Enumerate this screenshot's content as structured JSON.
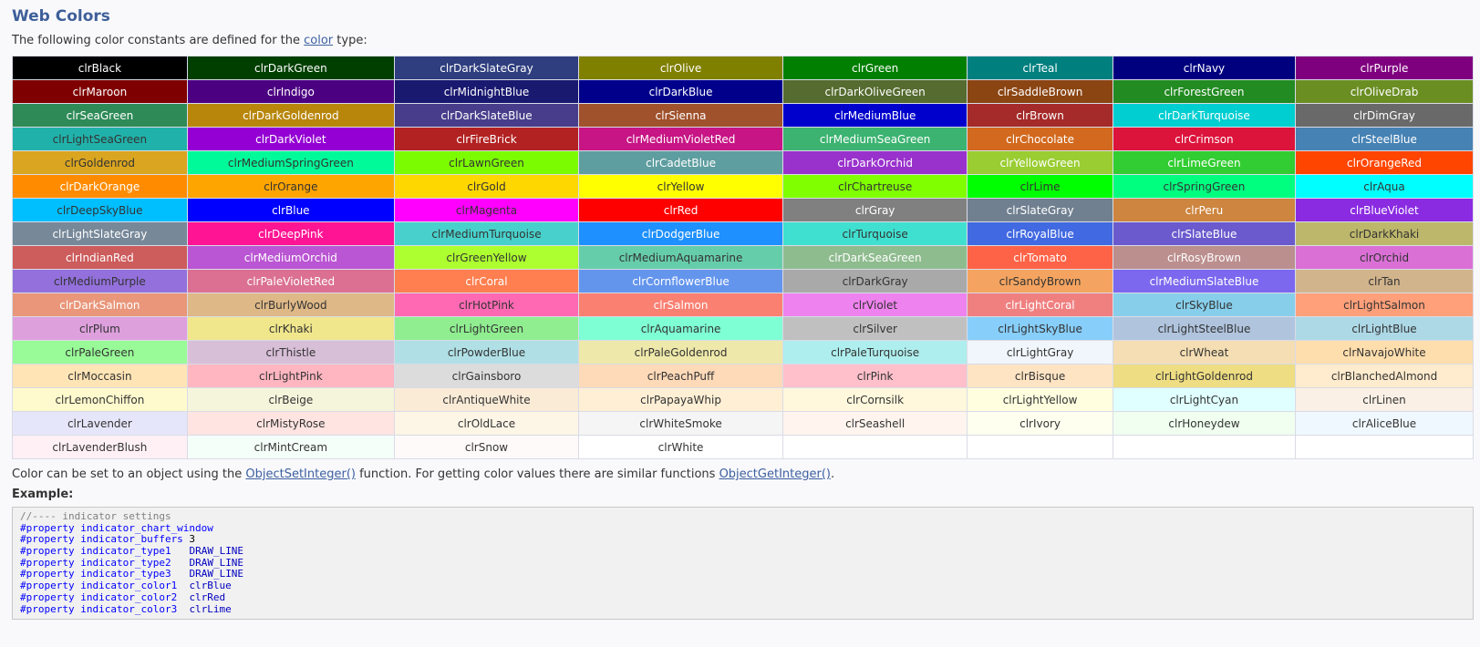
{
  "title": "Web Colors",
  "intro": {
    "before": "The following color constants are defined for the ",
    "link": "color",
    "after": " type:"
  },
  "columns": [
    185,
    219,
    195,
    216,
    195,
    154,
    193,
    188
  ],
  "colors": [
    [
      [
        "clrBlack",
        "#000000",
        "#ffffff"
      ],
      [
        "clrDarkGreen",
        "#003f00",
        "#ffffff"
      ],
      [
        "clrDarkSlateGray",
        "#2f3e7e",
        "#ffffff"
      ],
      [
        "clrOlive",
        "#7f7f00",
        "#ffffff"
      ],
      [
        "clrGreen",
        "#007f00",
        "#ffffff"
      ],
      [
        "clrTeal",
        "#007f7f",
        "#ffffff"
      ],
      [
        "clrNavy",
        "#00007f",
        "#ffffff"
      ],
      [
        "clrPurple",
        "#7f007f",
        "#ffffff"
      ]
    ],
    [
      [
        "clrMaroon",
        "#7f0000",
        "#ffffff"
      ],
      [
        "clrIndigo",
        "#4b0082",
        "#ffffff"
      ],
      [
        "clrMidnightBlue",
        "#191970",
        "#ffffff"
      ],
      [
        "clrDarkBlue",
        "#00008b",
        "#ffffff"
      ],
      [
        "clrDarkOliveGreen",
        "#556b2f",
        "#ffffff"
      ],
      [
        "clrSaddleBrown",
        "#8b4513",
        "#ffffff"
      ],
      [
        "clrForestGreen",
        "#228b22",
        "#ffffff"
      ],
      [
        "clrOliveDrab",
        "#6b8e23",
        "#ffffff"
      ]
    ],
    [
      [
        "clrSeaGreen",
        "#2e8b57",
        "#ffffff"
      ],
      [
        "clrDarkGoldenrod",
        "#b8860b",
        "#ffffff"
      ],
      [
        "clrDarkSlateBlue",
        "#483d8b",
        "#ffffff"
      ],
      [
        "clrSienna",
        "#a0522d",
        "#ffffff"
      ],
      [
        "clrMediumBlue",
        "#0000cd",
        "#ffffff"
      ],
      [
        "clrBrown",
        "#a52a2a",
        "#ffffff"
      ],
      [
        "clrDarkTurquoise",
        "#00ced1",
        "#ffffff"
      ],
      [
        "clrDimGray",
        "#696969",
        "#ffffff"
      ]
    ],
    [
      [
        "clrLightSeaGreen",
        "#20b2aa",
        "#333333"
      ],
      [
        "clrDarkViolet",
        "#9400d3",
        "#ffffff"
      ],
      [
        "clrFireBrick",
        "#b22222",
        "#ffffff"
      ],
      [
        "clrMediumVioletRed",
        "#c71585",
        "#ffffff"
      ],
      [
        "clrMediumSeaGreen",
        "#3cb371",
        "#ffffff"
      ],
      [
        "clrChocolate",
        "#d2691e",
        "#ffffff"
      ],
      [
        "clrCrimson",
        "#dc143c",
        "#ffffff"
      ],
      [
        "clrSteelBlue",
        "#4682b4",
        "#ffffff"
      ]
    ],
    [
      [
        "clrGoldenrod",
        "#daa520",
        "#333333"
      ],
      [
        "clrMediumSpringGreen",
        "#00fa9a",
        "#333333"
      ],
      [
        "clrLawnGreen",
        "#7cfc00",
        "#333333"
      ],
      [
        "clrCadetBlue",
        "#5f9ea0",
        "#ffffff"
      ],
      [
        "clrDarkOrchid",
        "#9932cc",
        "#ffffff"
      ],
      [
        "clrYellowGreen",
        "#9acd32",
        "#ffffff"
      ],
      [
        "clrLimeGreen",
        "#32cd32",
        "#ffffff"
      ],
      [
        "clrOrangeRed",
        "#ff4500",
        "#ffffff"
      ]
    ],
    [
      [
        "clrDarkOrange",
        "#ff8c00",
        "#ffffff"
      ],
      [
        "clrOrange",
        "#ffa500",
        "#333333"
      ],
      [
        "clrGold",
        "#ffd700",
        "#333333"
      ],
      [
        "clrYellow",
        "#ffff00",
        "#333333"
      ],
      [
        "clrChartreuse",
        "#7fff00",
        "#333333"
      ],
      [
        "clrLime",
        "#00ff00",
        "#333333"
      ],
      [
        "clrSpringGreen",
        "#00ff7f",
        "#333333"
      ],
      [
        "clrAqua",
        "#00ffff",
        "#333333"
      ]
    ],
    [
      [
        "clrDeepSkyBlue",
        "#00bfff",
        "#333333"
      ],
      [
        "clrBlue",
        "#0000ff",
        "#ffffff"
      ],
      [
        "clrMagenta",
        "#ff00ff",
        "#333333"
      ],
      [
        "clrRed",
        "#ff0000",
        "#ffffff"
      ],
      [
        "clrGray",
        "#808080",
        "#ffffff"
      ],
      [
        "clrSlateGray",
        "#708090",
        "#ffffff"
      ],
      [
        "clrPeru",
        "#cd853f",
        "#ffffff"
      ],
      [
        "clrBlueViolet",
        "#8a2be2",
        "#ffffff"
      ]
    ],
    [
      [
        "clrLightSlateGray",
        "#778899",
        "#ffffff"
      ],
      [
        "clrDeepPink",
        "#ff1493",
        "#ffffff"
      ],
      [
        "clrMediumTurquoise",
        "#48d1cc",
        "#333333"
      ],
      [
        "clrDodgerBlue",
        "#1e90ff",
        "#ffffff"
      ],
      [
        "clrTurquoise",
        "#40e0d0",
        "#333333"
      ],
      [
        "clrRoyalBlue",
        "#4169e1",
        "#ffffff"
      ],
      [
        "clrSlateBlue",
        "#6a5acd",
        "#ffffff"
      ],
      [
        "clrDarkKhaki",
        "#bdb76b",
        "#333333"
      ]
    ],
    [
      [
        "clrIndianRed",
        "#cd5c5c",
        "#ffffff"
      ],
      [
        "clrMediumOrchid",
        "#ba55d3",
        "#ffffff"
      ],
      [
        "clrGreenYellow",
        "#adff2f",
        "#333333"
      ],
      [
        "clrMediumAquamarine",
        "#66cdaa",
        "#333333"
      ],
      [
        "clrDarkSeaGreen",
        "#8fbc8f",
        "#ffffff"
      ],
      [
        "clrTomato",
        "#ff6347",
        "#ffffff"
      ],
      [
        "clrRosyBrown",
        "#bc8f8f",
        "#ffffff"
      ],
      [
        "clrOrchid",
        "#da70d6",
        "#333333"
      ]
    ],
    [
      [
        "clrMediumPurple",
        "#9370db",
        "#333333"
      ],
      [
        "clrPaleVioletRed",
        "#db7093",
        "#ffffff"
      ],
      [
        "clrCoral",
        "#ff7f50",
        "#ffffff"
      ],
      [
        "clrCornflowerBlue",
        "#6495ed",
        "#ffffff"
      ],
      [
        "clrDarkGray",
        "#a9a9a9",
        "#333333"
      ],
      [
        "clrSandyBrown",
        "#f4a460",
        "#333333"
      ],
      [
        "clrMediumSlateBlue",
        "#7b68ee",
        "#ffffff"
      ],
      [
        "clrTan",
        "#d2b48c",
        "#333333"
      ]
    ],
    [
      [
        "clrDarkSalmon",
        "#e9967a",
        "#ffffff"
      ],
      [
        "clrBurlyWood",
        "#deb887",
        "#333333"
      ],
      [
        "clrHotPink",
        "#ff69b4",
        "#333333"
      ],
      [
        "clrSalmon",
        "#fa8072",
        "#ffffff"
      ],
      [
        "clrViolet",
        "#ee82ee",
        "#333333"
      ],
      [
        "clrLightCoral",
        "#f08080",
        "#ffffff"
      ],
      [
        "clrSkyBlue",
        "#87ceeb",
        "#333333"
      ],
      [
        "clrLightSalmon",
        "#ffa07a",
        "#333333"
      ]
    ],
    [
      [
        "clrPlum",
        "#dda0dd",
        "#333333"
      ],
      [
        "clrKhaki",
        "#f0e68c",
        "#333333"
      ],
      [
        "clrLightGreen",
        "#90ee90",
        "#333333"
      ],
      [
        "clrAquamarine",
        "#7fffd4",
        "#333333"
      ],
      [
        "clrSilver",
        "#c0c0c0",
        "#333333"
      ],
      [
        "clrLightSkyBlue",
        "#87cefa",
        "#333333"
      ],
      [
        "clrLightSteelBlue",
        "#b0c4de",
        "#333333"
      ],
      [
        "clrLightBlue",
        "#add8e6",
        "#333333"
      ]
    ],
    [
      [
        "clrPaleGreen",
        "#98fb98",
        "#333333"
      ],
      [
        "clrThistle",
        "#d8bfd8",
        "#333333"
      ],
      [
        "clrPowderBlue",
        "#b0e0e6",
        "#333333"
      ],
      [
        "clrPaleGoldenrod",
        "#eee8aa",
        "#333333"
      ],
      [
        "clrPaleTurquoise",
        "#afeeee",
        "#333333"
      ],
      [
        "clrLightGray",
        "#f0f6fb",
        "#333333"
      ],
      [
        "clrWheat",
        "#f5deb3",
        "#333333"
      ],
      [
        "clrNavajoWhite",
        "#ffdead",
        "#333333"
      ]
    ],
    [
      [
        "clrMoccasin",
        "#ffe4b5",
        "#333333"
      ],
      [
        "clrLightPink",
        "#ffb6c1",
        "#333333"
      ],
      [
        "clrGainsboro",
        "#dcdcdc",
        "#333333"
      ],
      [
        "clrPeachPuff",
        "#ffdab9",
        "#333333"
      ],
      [
        "clrPink",
        "#ffc0cb",
        "#333333"
      ],
      [
        "clrBisque",
        "#ffe4c4",
        "#333333"
      ],
      [
        "clrLightGoldenrod",
        "#eedd82",
        "#333333"
      ],
      [
        "clrBlanchedAlmond",
        "#ffebcd",
        "#333333"
      ]
    ],
    [
      [
        "clrLemonChiffon",
        "#fffacd",
        "#333333"
      ],
      [
        "clrBeige",
        "#f5f5dc",
        "#333333"
      ],
      [
        "clrAntiqueWhite",
        "#faebd7",
        "#333333"
      ],
      [
        "clrPapayaWhip",
        "#ffefd5",
        "#333333"
      ],
      [
        "clrCornsilk",
        "#fff8dc",
        "#333333"
      ],
      [
        "clrLightYellow",
        "#ffffe0",
        "#333333"
      ],
      [
        "clrLightCyan",
        "#e0ffff",
        "#333333"
      ],
      [
        "clrLinen",
        "#faf0e6",
        "#333333"
      ]
    ],
    [
      [
        "clrLavender",
        "#e6e6fa",
        "#333333"
      ],
      [
        "clrMistyRose",
        "#ffe4e1",
        "#333333"
      ],
      [
        "clrOldLace",
        "#fdf5e6",
        "#333333"
      ],
      [
        "clrWhiteSmoke",
        "#f5f5f5",
        "#333333"
      ],
      [
        "clrSeashell",
        "#fff5ee",
        "#333333"
      ],
      [
        "clrIvory",
        "#fffff0",
        "#333333"
      ],
      [
        "clrHoneydew",
        "#f0fff0",
        "#333333"
      ],
      [
        "clrAliceBlue",
        "#f0f8ff",
        "#333333"
      ]
    ],
    [
      [
        "clrLavenderBlush",
        "#fff0f5",
        "#333333"
      ],
      [
        "clrMintCream",
        "#f5fffa",
        "#333333"
      ],
      [
        "clrSnow",
        "#fffafa",
        "#333333"
      ],
      [
        "clrWhite",
        "#ffffff",
        "#333333"
      ],
      null,
      null,
      null,
      null
    ]
  ],
  "note": {
    "before": "Color can be set to an object using the ",
    "link1": "ObjectSetInteger()",
    "middle": " function. For getting color values there are similar functions ",
    "link2": "ObjectGetInteger()",
    "after": "."
  },
  "example_label": "Example:",
  "code": [
    [
      [
        "comment",
        "//---- indicator settings"
      ]
    ],
    [
      [
        "kw",
        "#property indicator_chart_window"
      ]
    ],
    [
      [
        "kw",
        "#property indicator_buffers"
      ],
      [
        "plain",
        " 3"
      ]
    ],
    [
      [
        "kw",
        "#property indicator_type1"
      ],
      [
        "plain",
        "   "
      ],
      [
        "val",
        "DRAW_LINE"
      ]
    ],
    [
      [
        "kw",
        "#property indicator_type2"
      ],
      [
        "plain",
        "   "
      ],
      [
        "val",
        "DRAW_LINE"
      ]
    ],
    [
      [
        "kw",
        "#property indicator_type3"
      ],
      [
        "plain",
        "   "
      ],
      [
        "val",
        "DRAW_LINE"
      ]
    ],
    [
      [
        "kw",
        "#property indicator_color1"
      ],
      [
        "plain",
        "  "
      ],
      [
        "val",
        "clrBlue"
      ]
    ],
    [
      [
        "kw",
        "#property indicator_color2"
      ],
      [
        "plain",
        "  "
      ],
      [
        "val",
        "clrRed"
      ]
    ],
    [
      [
        "kw",
        "#property indicator_color3"
      ],
      [
        "plain",
        "  "
      ],
      [
        "val",
        "clrLime"
      ]
    ]
  ]
}
